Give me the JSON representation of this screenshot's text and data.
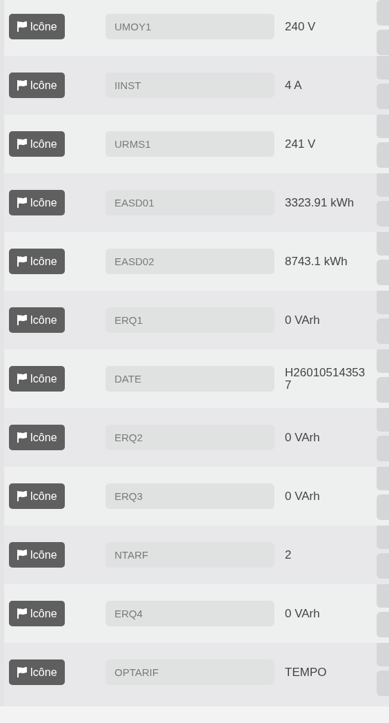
{
  "rows": [
    {
      "button": "Icône",
      "placeholder": "UMOY1",
      "value": "240 V"
    },
    {
      "button": "Icône",
      "placeholder": "IINST",
      "value": "4 A"
    },
    {
      "button": "Icône",
      "placeholder": "URMS1",
      "value": "241 V"
    },
    {
      "button": "Icône",
      "placeholder": "EASD01",
      "value": "3323.91 kWh"
    },
    {
      "button": "Icône",
      "placeholder": "EASD02",
      "value": "8743.1 kWh"
    },
    {
      "button": "Icône",
      "placeholder": "ERQ1",
      "value": "0 VArh"
    },
    {
      "button": "Icône",
      "placeholder": "DATE",
      "value": "H260105143537"
    },
    {
      "button": "Icône",
      "placeholder": "ERQ2",
      "value": "0 VArh"
    },
    {
      "button": "Icône",
      "placeholder": "ERQ3",
      "value": "0 VArh"
    },
    {
      "button": "Icône",
      "placeholder": "NTARF",
      "value": "2"
    },
    {
      "button": "Icône",
      "placeholder": "ERQ4",
      "value": "0 VArh"
    },
    {
      "button": "Icône",
      "placeholder": "OPTARIF",
      "value": "TEMPO"
    }
  ]
}
